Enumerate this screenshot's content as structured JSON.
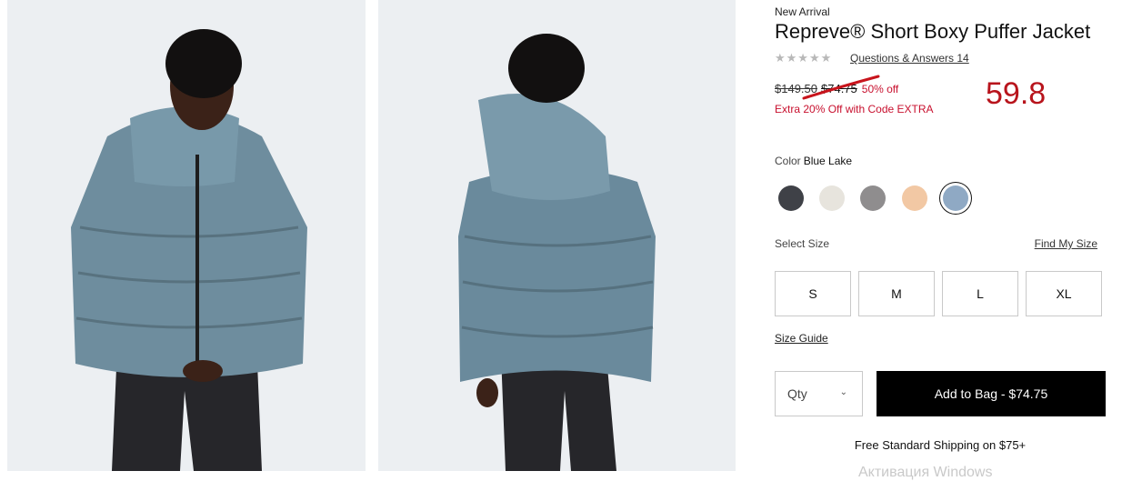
{
  "product": {
    "badge": "New Arrival",
    "title": "Repreve® Short Boxy Puffer Jacket",
    "rating_stars": "★★★★★",
    "qa_link": "Questions & Answers 14",
    "original_price": "$149.50",
    "sale_price": "$74.75",
    "discount": "50% off",
    "promo": "Extra 20% Off with Code EXTRA",
    "annotation": "59.8"
  },
  "color": {
    "label": "Color",
    "selected": "Blue Lake",
    "swatches": [
      {
        "name": "charcoal",
        "hex": "#3f4147"
      },
      {
        "name": "ivory",
        "hex": "#e7e4dd"
      },
      {
        "name": "grey",
        "hex": "#8f8d8e"
      },
      {
        "name": "peach",
        "hex": "#f2c8a4"
      },
      {
        "name": "blue-lake",
        "hex": "#8fa9c4"
      }
    ]
  },
  "size": {
    "label": "Select Size",
    "find_link": "Find My Size",
    "options": [
      "S",
      "M",
      "L",
      "XL"
    ],
    "guide_link": "Size Guide"
  },
  "cart": {
    "qty_placeholder": "Qty",
    "add_button": "Add to Bag - $74.75",
    "shipping": "Free Standard Shipping on $75+"
  },
  "overlay": {
    "watermark": "Активация Windows"
  },
  "colors": {
    "accent_red": "#c8102e",
    "button_black": "#000000"
  }
}
